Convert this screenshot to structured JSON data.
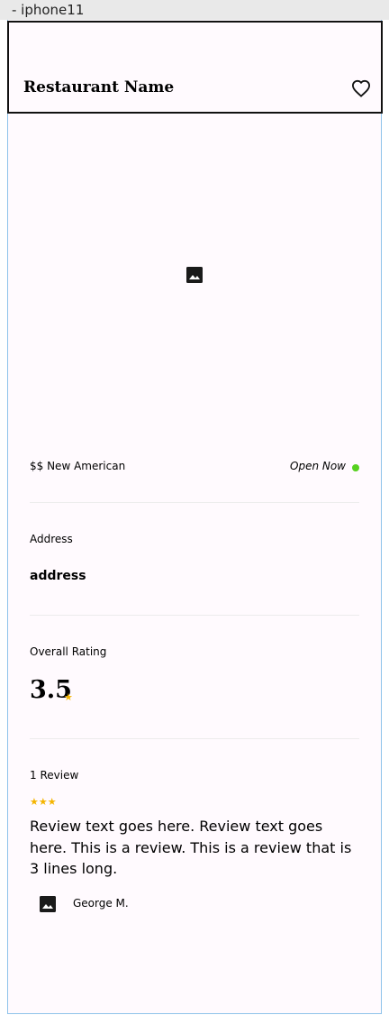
{
  "frame": {
    "label": "- iphone11"
  },
  "header": {
    "title": "Restaurant Name",
    "favorite_icon": "heart-outline-icon"
  },
  "hero": {
    "icon": "image-icon"
  },
  "info": {
    "price_category": "$$ New American",
    "status": "Open Now",
    "status_color": "#56d11f"
  },
  "address": {
    "label": "Address",
    "value": "address"
  },
  "rating": {
    "label": "Overall Rating",
    "value": "3.5",
    "star_color": "#f4b400"
  },
  "reviews": {
    "count_label": "1 Review",
    "items": [
      {
        "stars": 3,
        "text": "Review text goes here. Review text goes here. This is a review. This is a review that is 3 lines long.",
        "author": "George M.",
        "avatar_icon": "image-icon"
      }
    ]
  }
}
